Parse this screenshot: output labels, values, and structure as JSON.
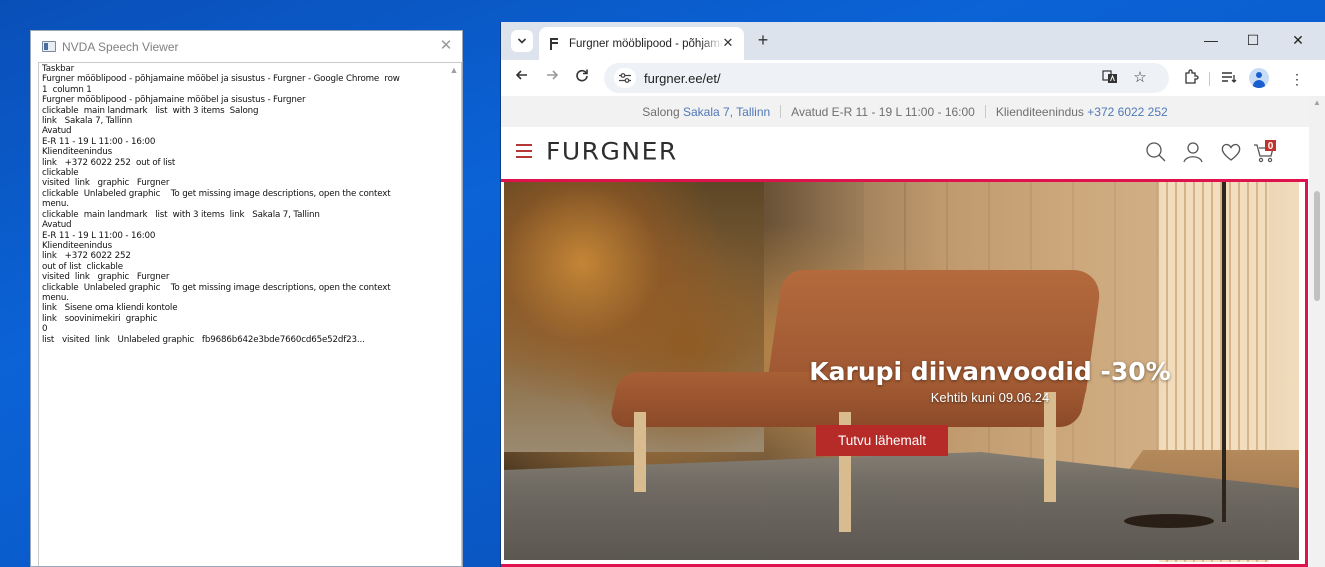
{
  "nvda": {
    "title": "NVDA Speech Viewer",
    "lines": [
      "Taskbar",
      "Furgner mööblipood - põhjamaine mööbel ja sisustus - Furgner - Google Chrome  row",
      "1  column 1",
      "Furgner mööblipood - põhjamaine mööbel ja sisustus - Furgner",
      "clickable  main landmark   list  with 3 items  Salong",
      "link   Sakala 7, Tallinn",
      "Avatud",
      "E-R 11 - 19 L 11:00 - 16:00",
      "Klienditeenindus",
      "link   +372 6022 252  out of list",
      "clickable",
      "visited  link   graphic   Furgner",
      "clickable  Unlabeled graphic    To get missing image descriptions, open the context",
      "menu.",
      "clickable  main landmark   list  with 3 items  link   Sakala 7, Tallinn",
      "Avatud",
      "E-R 11 - 19 L 11:00 - 16:00",
      "Klienditeenindus",
      "link   +372 6022 252",
      "out of list  clickable",
      "visited  link   graphic   Furgner",
      "clickable  Unlabeled graphic    To get missing image descriptions, open the context",
      "menu.",
      "link   Sisene oma kliendi kontole",
      "link   soovinimekiri  graphic",
      "0",
      "list   visited  link   Unlabeled graphic   fb9686b642e3bde7660cd65e52df23..."
    ]
  },
  "chrome": {
    "tab_title": "Furgner mööblipood - põhjamaine mööbel ja sisustus - Furgner",
    "url": "furgner.ee/et/",
    "window_controls": {
      "minimize": "—",
      "maximize": "☐",
      "close": "✕"
    }
  },
  "page": {
    "topbar": {
      "salong_label": "Salong",
      "salong_address": "Sakala 7, Tallinn",
      "hours": "Avatud E-R 11 - 19 L 11:00 - 16:00",
      "service_label": "Klienditeenindus",
      "service_phone": "+372 6022 252"
    },
    "logo": "FURGNER",
    "cart_count": "0",
    "hero": {
      "title": "Karupi diivanvoodid -30%",
      "subtitle": "Kehtib kuni 09.06.24",
      "button": "Tutvu lähemalt"
    }
  },
  "colors": {
    "desktop": "#0a57c4",
    "hero_border": "#e0124e",
    "button": "#b62b28",
    "link_accent": "#4f78b8",
    "menu_accent": "#b23838"
  }
}
